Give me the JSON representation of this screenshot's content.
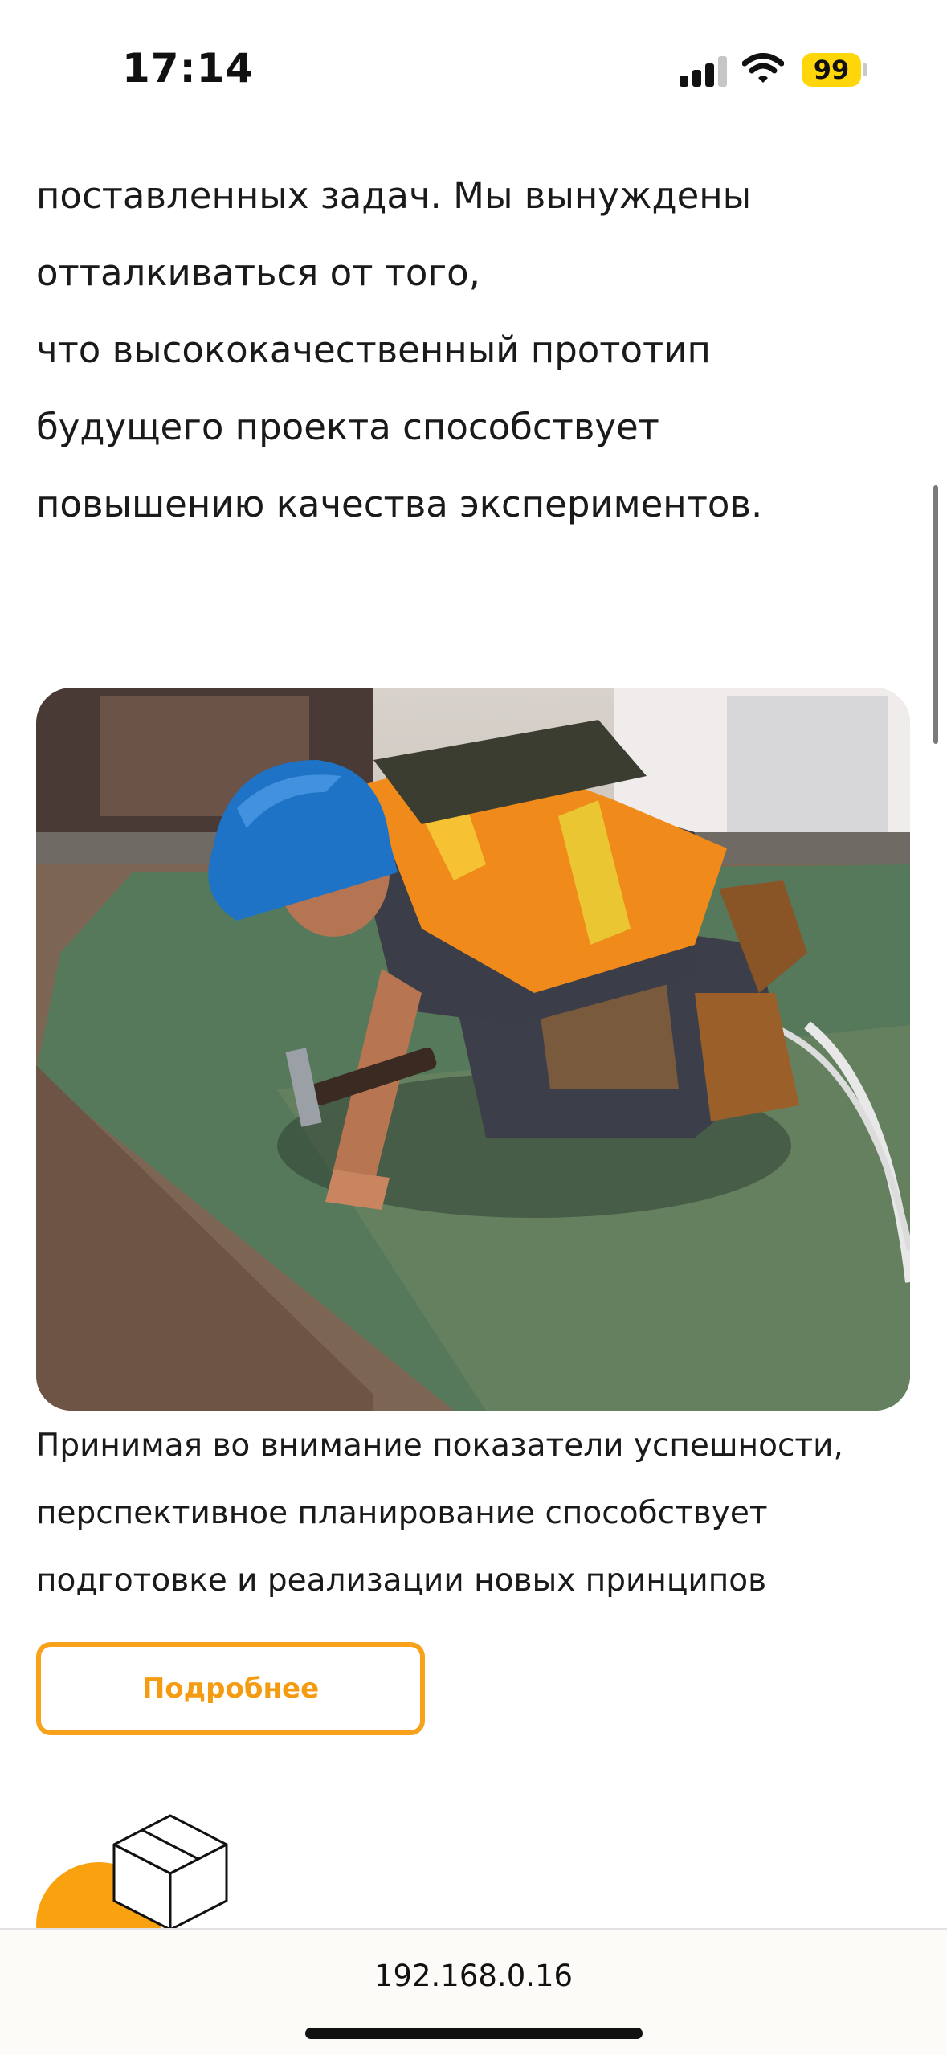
{
  "status_bar": {
    "time": "17:14",
    "battery": "99",
    "battery_color": "#ffd60a",
    "icons": [
      "cellular-signal-icon",
      "wifi-icon",
      "battery-icon"
    ]
  },
  "article": {
    "paragraph_1_lines": [
      "поставленных задач. Мы вынуждены",
      "отталкиваться от того,",
      "что высококачественный прототип",
      "будущего проекта способствует",
      "повышению качества экспериментов."
    ],
    "image_alt": "",
    "paragraph_2_lines": [
      "Принимая во внимание показатели успешности,",
      "перспективное планирование способствует",
      "подготовке и реализации новых принципов"
    ],
    "more_button_label": "Подробнее",
    "accent_color": "#f7a21a",
    "decor_icon": "box-icon"
  },
  "browser": {
    "url": "192.168.0.16"
  }
}
